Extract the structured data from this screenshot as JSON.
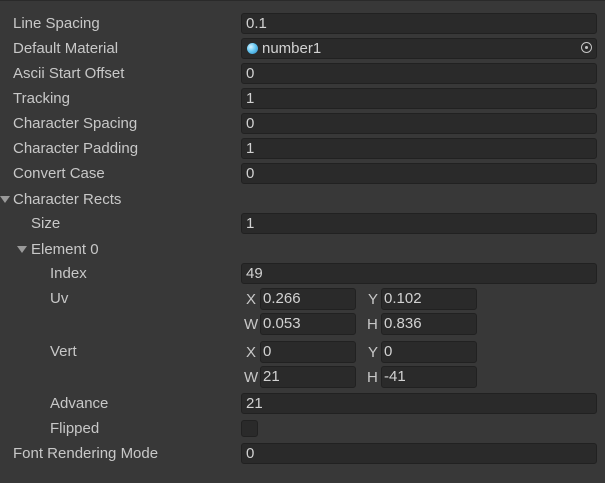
{
  "fields": {
    "line_spacing": {
      "label": "Line Spacing",
      "value": "0.1"
    },
    "default_material": {
      "label": "Default Material",
      "value": "number1"
    },
    "ascii_start_offset": {
      "label": "Ascii Start Offset",
      "value": "0"
    },
    "tracking": {
      "label": "Tracking",
      "value": "1"
    },
    "character_spacing": {
      "label": "Character Spacing",
      "value": "0"
    },
    "character_padding": {
      "label": "Character Padding",
      "value": "1"
    },
    "convert_case": {
      "label": "Convert Case",
      "value": "0"
    },
    "font_rendering_mode": {
      "label": "Font Rendering Mode",
      "value": "0"
    }
  },
  "character_rects": {
    "label": "Character Rects",
    "size": {
      "label": "Size",
      "value": "1"
    },
    "element": {
      "label": "Element 0",
      "index": {
        "label": "Index",
        "value": "49"
      },
      "uv": {
        "label": "Uv",
        "x_label": "X",
        "x": "0.266",
        "y_label": "Y",
        "y": "0.102",
        "w_label": "W",
        "w": "0.053",
        "h_label": "H",
        "h": "0.836"
      },
      "vert": {
        "label": "Vert",
        "x_label": "X",
        "x": "0",
        "y_label": "Y",
        "y": "0",
        "w_label": "W",
        "w": "21",
        "h_label": "H",
        "h": "-41"
      },
      "advance": {
        "label": "Advance",
        "value": "21"
      },
      "flipped": {
        "label": "Flipped",
        "checked": false
      }
    }
  },
  "icons": {
    "material": "material-sphere-icon",
    "picker": "object-picker-icon",
    "foldout": "foldout-arrow-icon"
  }
}
